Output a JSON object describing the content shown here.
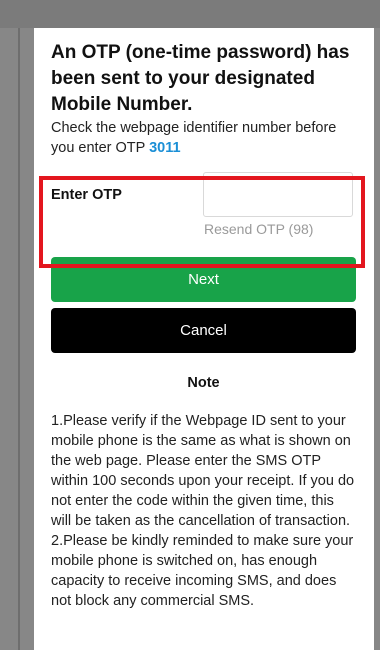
{
  "modal": {
    "title": "An OTP (one-time password) has been sent to your designated Mobile Number.",
    "instruction": "Check the webpage identifier number before you enter OTP",
    "webpage_id": "3011"
  },
  "otp": {
    "label": "Enter OTP",
    "value": "",
    "placeholder": "",
    "resend_label": "Resend OTP (98)"
  },
  "buttons": {
    "next_label": "Next",
    "cancel_label": "Cancel"
  },
  "note": {
    "heading": "Note",
    "items": [
      "1.Please verify if the Webpage ID sent to your mobile phone is the same as what is shown on the web page. Please enter the SMS OTP within 100 seconds upon your receipt. If you do not enter the code within the given time, this will be taken as the cancellation of transaction.",
      "2.Please be kindly reminded to make sure your mobile phone is switched on, has enough capacity to receive incoming SMS, and does not block any commercial SMS."
    ]
  },
  "colors": {
    "next_button": "#18a349",
    "cancel_button": "#000000",
    "webpage_id": "#1b8fd6",
    "highlight_box": "#e3161e",
    "overlay": "#878787"
  }
}
